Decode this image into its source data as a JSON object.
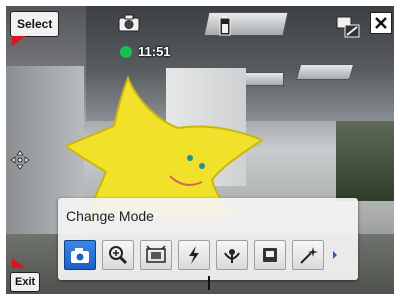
{
  "top_bar": {
    "select_label": "Select",
    "time": "11:51",
    "icons": [
      "camera-icon",
      "battery-icon",
      "resolution-icon",
      "close-icon"
    ]
  },
  "bottom_bar": {
    "exit_label": "Exit"
  },
  "mode_panel": {
    "title": "Change Mode",
    "modes": [
      {
        "name": "photo-mode-icon",
        "selected": true
      },
      {
        "name": "zoom-mode-icon",
        "selected": false
      },
      {
        "name": "video-mode-icon",
        "selected": false
      },
      {
        "name": "flash-mode-icon",
        "selected": false
      },
      {
        "name": "macro-mode-icon",
        "selected": false
      },
      {
        "name": "scene-mode-icon",
        "selected": false
      },
      {
        "name": "effect-mode-icon",
        "selected": false
      }
    ]
  },
  "colors": {
    "accent": "#1a5fc4",
    "status_dot": "#18c14a",
    "marker": "#d8161b"
  }
}
